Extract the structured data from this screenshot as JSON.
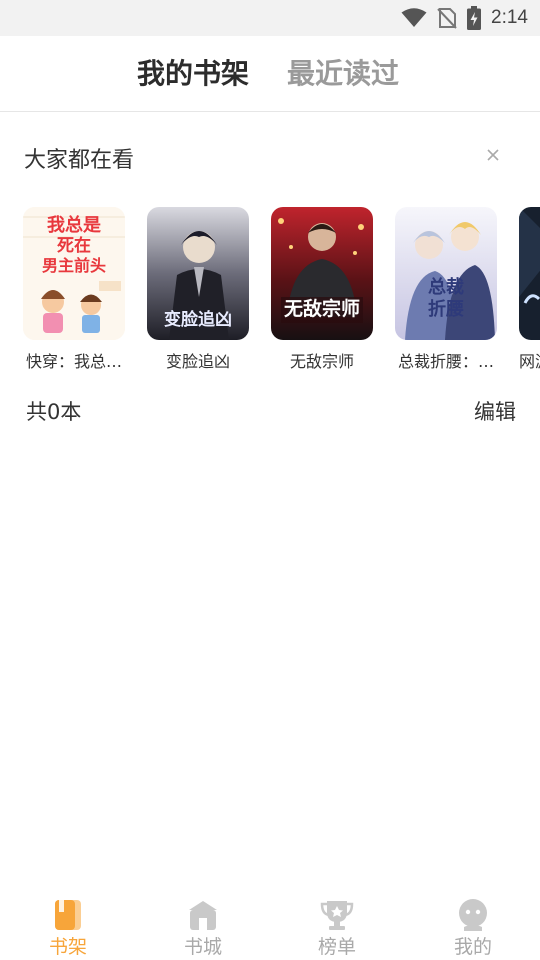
{
  "status_bar": {
    "time": "2:14",
    "icons": [
      "wifi-icon",
      "no-sim-icon",
      "battery-charging-icon"
    ]
  },
  "header": {
    "tabs": [
      {
        "label": "我的书架",
        "active": true
      },
      {
        "label": "最近读过",
        "active": false
      }
    ]
  },
  "recommend": {
    "title": "大家都在看",
    "close_icon": "close-icon",
    "books": [
      {
        "title": "快穿：我总…",
        "cover_text": "我总是\n死在\n男主前头"
      },
      {
        "title": "变脸追凶",
        "cover_text": "变脸追凶"
      },
      {
        "title": "无敌宗师",
        "cover_text": "无敌宗师"
      },
      {
        "title": "总裁折腰：…",
        "cover_text": "总裁\n折腰"
      },
      {
        "title": "网游",
        "cover_text": ""
      }
    ]
  },
  "shelf": {
    "count_label": "共0本",
    "edit_label": "编辑"
  },
  "bottom_nav": {
    "items": [
      {
        "label": "书架",
        "icon": "book-icon",
        "active": true
      },
      {
        "label": "书城",
        "icon": "store-icon",
        "active": false
      },
      {
        "label": "榜单",
        "icon": "trophy-icon",
        "active": false
      },
      {
        "label": "我的",
        "icon": "profile-icon",
        "active": false
      }
    ]
  },
  "colors": {
    "accent": "#f7a53a",
    "inactive": "#a9a9a9",
    "status_bar_bg": "#f2f2f2"
  }
}
